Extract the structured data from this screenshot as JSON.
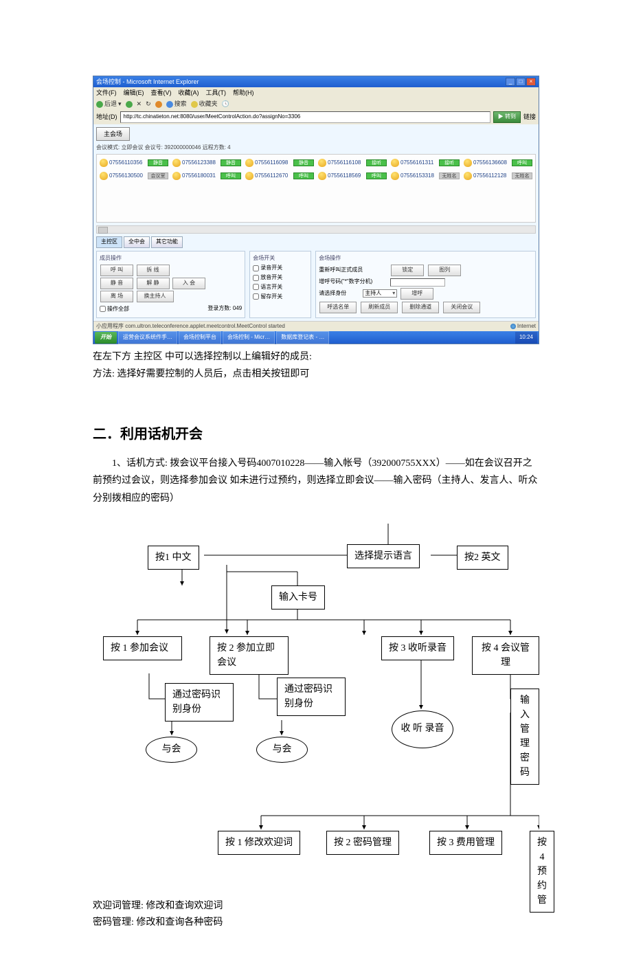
{
  "ie": {
    "title": "会场控制 - Microsoft Internet Explorer",
    "menus": [
      "文件(F)",
      "编辑(E)",
      "查看(V)",
      "收藏(A)",
      "工具(T)",
      "帮助(H)"
    ],
    "toolbar": {
      "back": "后退",
      "search": "搜索",
      "fav": "收藏夹"
    },
    "addr_label": "地址(D)",
    "url": "http://tc.chinatieton.net:8080/user/MeetControlAction.do?assignNo=3306",
    "go": "转到",
    "links": "链接",
    "main_btn": "主会场",
    "meta": "会议模式: 立即会议    会议号: 392000000046    远程方数: 4",
    "participants_row1": [
      {
        "num": "07556110356",
        "stat": "静音",
        "gray": false
      },
      {
        "num": "07556123388",
        "stat": "静音",
        "gray": false
      },
      {
        "num": "07556116098",
        "stat": "静音",
        "gray": false
      },
      {
        "num": "07556116108",
        "stat": "接听",
        "gray": false
      },
      {
        "num": "07556161311",
        "stat": "接听",
        "gray": false
      },
      {
        "num": "07556136608",
        "stat": "呼叫",
        "gray": false
      }
    ],
    "participants_row2": [
      {
        "num": "07556130500",
        "stat": "会议室",
        "gray": true
      },
      {
        "num": "07556180031",
        "stat": "呼叫",
        "gray": false
      },
      {
        "num": "07556112670",
        "stat": "呼叫",
        "gray": false
      },
      {
        "num": "07556118569",
        "stat": "呼叫",
        "gray": false
      },
      {
        "num": "07556153318",
        "stat": "无姓名",
        "gray": true
      },
      {
        "num": "07556112128",
        "stat": "无姓名",
        "gray": true
      }
    ],
    "tabs": [
      "主控区",
      "全中会",
      "其它功能"
    ],
    "member_ops_title": "成员操作",
    "member_ops": [
      "呼   叫",
      "拆   线",
      "静   音",
      "解   静",
      "入   会",
      "离   场",
      "换主持人"
    ],
    "ops_checkbox": "操作全部",
    "login_count": "登录方数: 049",
    "switch_title": "会场开关",
    "switches": [
      "录音开关",
      "放音开关",
      "语言开关",
      "留存开关"
    ],
    "conf_ops_title": "会场操作",
    "recall_label": "重新呼叫正式成员",
    "addnum_label": "增呼号码(\"*\"数字分机)",
    "choose_identity": "请选择身份",
    "identity_value": "主持人",
    "btns_right": {
      "lock": "锁定",
      "list": "图列",
      "add": "增呼",
      "refresh_mem": "刷新成员",
      "del_chan": "删除通道",
      "end_conf": "关闭会议"
    },
    "btn_call_list": "呼选名单",
    "status_left": "小应用程序 com.ultron.teleconference.applet.meetcontrol.MeetControl started",
    "status_right": "Internet"
  },
  "taskbar": {
    "start": "开始",
    "items": [
      "运营会议系统作手…",
      "会场控制平台",
      "会场控制 - Micr…",
      "数据库登记表 - …"
    ],
    "time": "10:24"
  },
  "body": {
    "line1": "在左下方 主控区 中可以选择控制以上编辑好的成员:",
    "line2": "方法: 选择好需要控制的人员后，点击相关按钮即可",
    "heading": "二．利用话机开会",
    "para": "1、话机方式: 拨会议平台接入号码4007010228——输入帐号（392000755XXX）——如在会议召开之前预约过会议，则选择参加会议 如未进行过预约，则选择立即会议——输入密码（主持人、发言人、听众分别拨相应的密码）"
  },
  "flow": {
    "select_lang": "选择提示语言",
    "press1_cn": "按1   中文",
    "press2_en": "按2   英文",
    "enter_card": "输入卡号",
    "opt1": "按 1 参加会议",
    "opt2": "按 2 参加立即会议",
    "opt3": "按 3 收听录音",
    "opt4": "按 4 会议管理",
    "pwd_id1": "通过密码识别身份",
    "pwd_id2": "通过密码识别身份",
    "listen": "收 听 录音",
    "enter_mgr_pwd": "输入管理密码",
    "join1": "与会",
    "join2": "与会",
    "m1": "按 1 修改欢迎词",
    "m2": "按 2 密码管理",
    "m3": "按 3 费用管理",
    "m4": "按 4 预约管"
  },
  "footer": {
    "l1": "欢迎词管理: 修改和查询欢迎词",
    "l2": "密码管理: 修改和查询各种密码"
  }
}
